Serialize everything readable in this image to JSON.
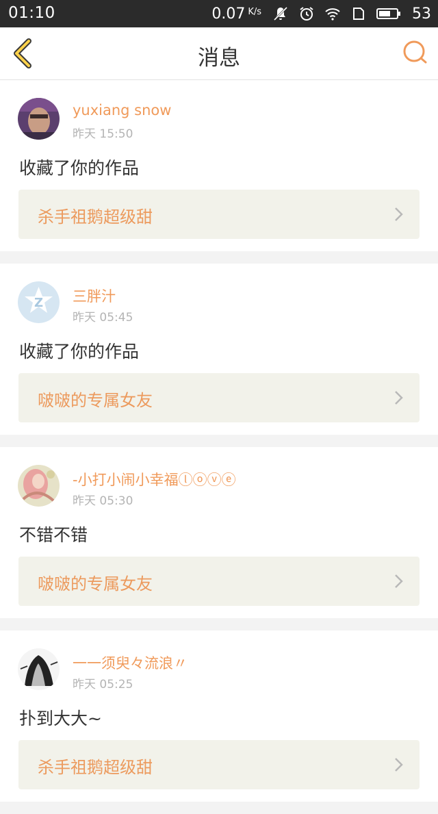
{
  "status_bar": {
    "time": "01:10",
    "net_speed": "0.07",
    "net_unit": "K/s",
    "battery": "53"
  },
  "nav": {
    "title": "消息"
  },
  "colors": {
    "accent": "#f09a5a",
    "work_box": "#f2f2ea"
  },
  "messages": [
    {
      "username": "yuxiang snow",
      "time": "昨天 15:50",
      "action": "收藏了你的作品",
      "work_title": "杀手祖鹅超级甜"
    },
    {
      "username": "三胖汁",
      "time": "昨天 05:45",
      "action": "收藏了你的作品",
      "work_title": "啵啵的专属女友"
    },
    {
      "username": "-小打小闹小幸福ⓛⓞⓥⓔ",
      "time": "昨天 05:30",
      "action": "不错不错",
      "work_title": "啵啵的专属女友"
    },
    {
      "username": "一一须臾々流浪〃",
      "time": "昨天 05:25",
      "action": "扑到大大~",
      "work_title": "杀手祖鹅超级甜"
    }
  ]
}
